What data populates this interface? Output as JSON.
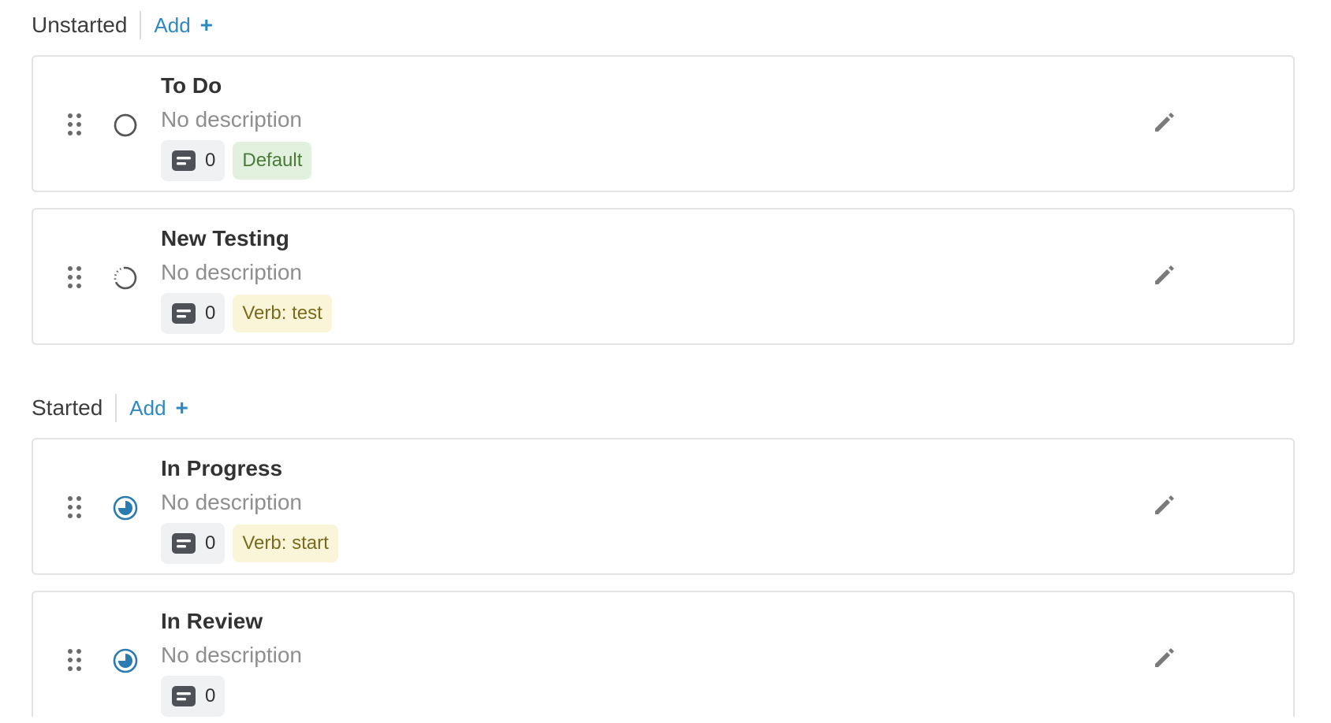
{
  "groups": [
    {
      "title": "Unstarted",
      "add_label": "Add",
      "add_plus": "+",
      "items": [
        {
          "title": "To Do",
          "description": "No description",
          "count": "0",
          "badge": "Default",
          "badge_color": "#e2f1de",
          "status_icon": "dashed-circle-icon"
        },
        {
          "title": "New Testing",
          "description": "No description",
          "count": "0",
          "badge": "Verb: test",
          "badge_color": "#faf5d9",
          "status_icon": "dashed-circle-icon"
        }
      ]
    },
    {
      "title": "Started",
      "add_label": "Add",
      "add_plus": "+",
      "items": [
        {
          "title": "In Progress",
          "description": "No description",
          "count": "0",
          "badge": "Verb: start",
          "badge_color": "#faf5d9",
          "status_icon": "progress-circle-icon"
        },
        {
          "title": "In Review",
          "description": "No description",
          "count": "0",
          "badge": "",
          "status_icon": "progress-circle-icon"
        }
      ]
    }
  ],
  "colors": {
    "accent": "#2f89c1",
    "progress_icon": "#2a7bb0",
    "badge_green_text": "#4a7a3a",
    "badge_yellow_text": "#7a6a1c"
  }
}
